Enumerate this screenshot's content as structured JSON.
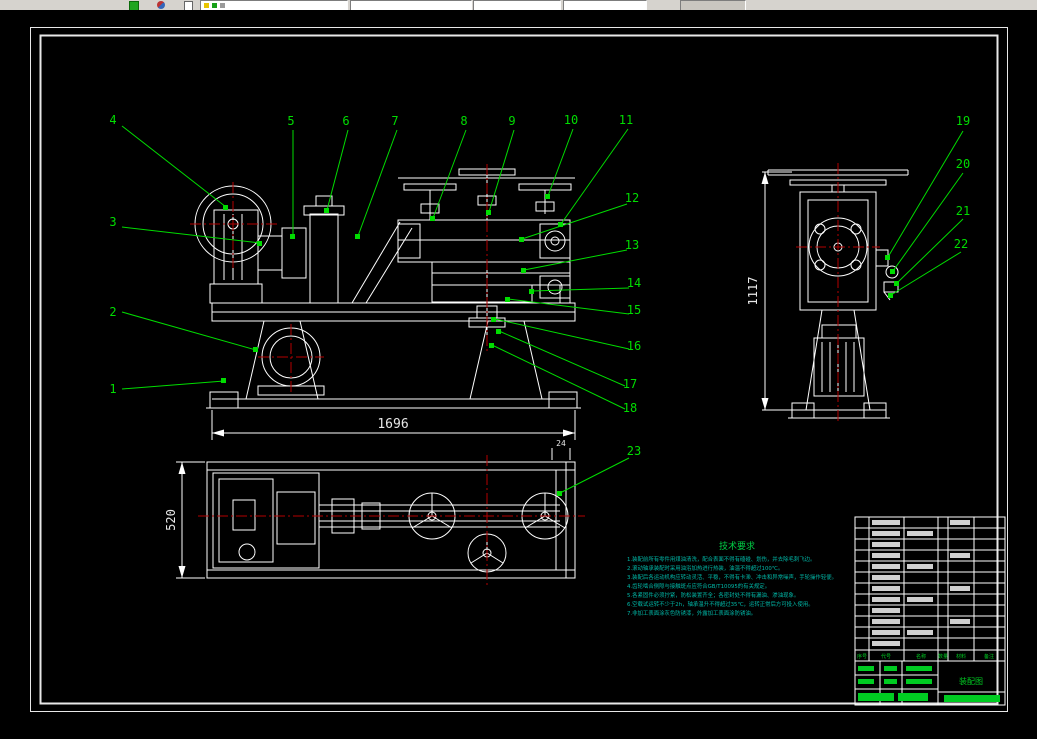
{
  "toolbar": {
    "icons": {
      "layer_icon": "green-grid-square",
      "color_wheel_icon": "two-tone-circle",
      "sheet_icon": "blank-page"
    }
  },
  "callouts": [
    "1",
    "2",
    "3",
    "4",
    "5",
    "6",
    "7",
    "8",
    "9",
    "10",
    "11",
    "12",
    "13",
    "14",
    "15",
    "16",
    "17",
    "18",
    "19",
    "20",
    "21",
    "22",
    "23"
  ],
  "dimensions": {
    "front_width": "1696",
    "side_height": "1117",
    "top_width": "520",
    "detail": "24"
  },
  "tech_requirements": {
    "title": "技术要求",
    "lines": [
      "1.装配前所有零件用煤油清洗，配合表面不得有磕碰、划伤，并去除毛刺飞边。",
      "2.滚动轴承装配时采用油浴加热进行热装，油温不得超过100℃。",
      "3.装配后各运动机构应转动灵活、平稳，不得有卡滞、冲击和异常噪声，手轮操作轻便。",
      "4.齿轮啮合侧隙与接触斑点应符合GB/T10095的有关规定。",
      "5.各紧固件必须拧紧，防松装置齐全；各密封处不得有漏油、渗油现象。",
      "6.空载试运转不少于2h，轴承温升不得超过35℃，运转正常后方可投入使用。",
      "7.非加工表面涂灰色防锈漆，外露加工表面涂防锈油。"
    ]
  },
  "parts_table": {
    "headers": [
      "序号",
      "代号",
      "名称",
      "数量",
      "材料",
      "备注"
    ]
  },
  "title_block": {
    "drawing_title": "装配图"
  },
  "colors": {
    "callout_green": "#00dd00",
    "centerline_red": "#b40000",
    "line_white": "#ffffff",
    "tech_text": "#00b8a8",
    "background": "#000000",
    "toolbar_bg": "#d6d3ce"
  }
}
